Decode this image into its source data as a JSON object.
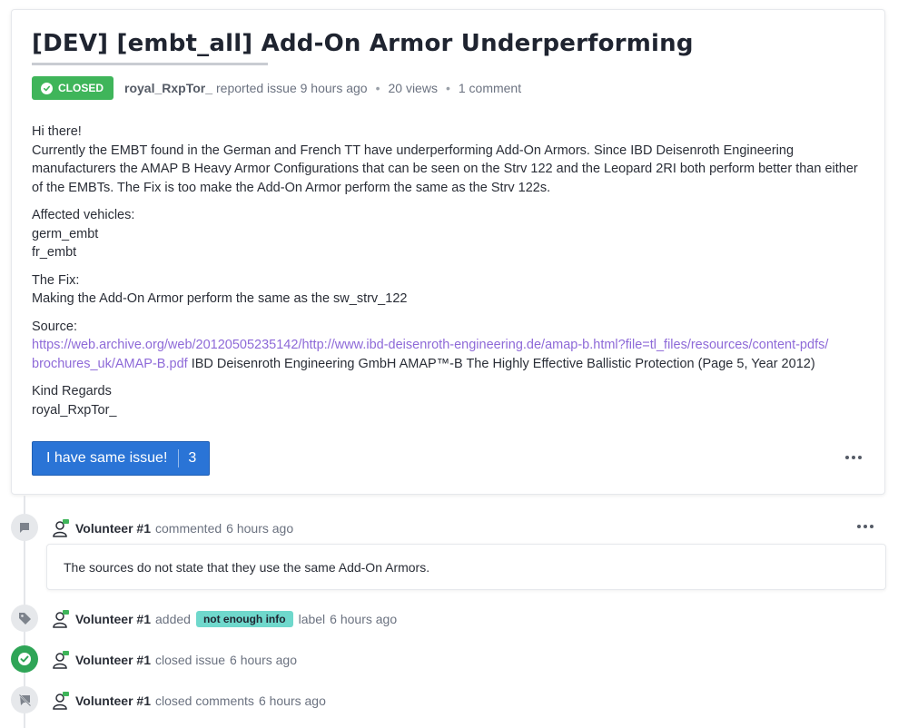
{
  "issue": {
    "title": "[DEV] [embt_all] Add-On Armor Underperforming",
    "status": "CLOSED",
    "author": "royal_RxpTor_",
    "reported_text": "reported issue 9 hours ago",
    "views": "20 views",
    "comments": "1 comment",
    "body": {
      "greeting": "Hi there!",
      "paragraph1": "Currently the EMBT found in the German and French TT have underperforming Add-On Armors. Since IBD Deisenroth Engineering manufacturers the AMAP B Heavy Armor Configurations that can be seen on the Strv 122 and the Leopard 2RI both perform better than either of the EMBTs. The Fix is too make the Add-On Armor perform the same as the Strv 122s.",
      "affected_label": "Affected vehicles:",
      "vehicle1": "germ_embt",
      "vehicle2": "fr_embt",
      "fix_label": "The Fix:",
      "fix_text": "Making the Add-On Armor perform the same as the sw_strv_122",
      "source_label": "Source:",
      "source_link_line1": "https://web.archive.org/web/20120505235142/http://www.ibd-deisenroth-engineering.de/amap-b.html?file=tl_files/resources/content-pdfs/",
      "source_link_line2": "brochures_uk/AMAP-B.pdf",
      "source_desc": " IBD Deisenroth Engineering GmbH AMAP™-B The Highly Effective Ballistic Protection (Page 5, Year 2012)",
      "closing": "Kind Regards",
      "signature": "royal_RxpTor_"
    },
    "same_issue_label": "I have same issue!",
    "same_issue_count": "3"
  },
  "timeline": {
    "comment_event": {
      "user": "Volunteer #1",
      "action": "commented",
      "time": "6 hours ago",
      "text": "The sources do not state that they use the same Add-On Armors."
    },
    "label_event": {
      "user": "Volunteer #1",
      "action": "added",
      "label": "not enough info",
      "suffix": "label",
      "time": "6 hours ago"
    },
    "close_event": {
      "user": "Volunteer #1",
      "action": "closed issue",
      "time": "6 hours ago"
    },
    "lock_event": {
      "user": "Volunteer #1",
      "action": "closed comments",
      "time": "6 hours ago"
    }
  },
  "icons": {
    "status_check": "check-circle-icon",
    "comment": "comment-icon",
    "tag": "tag-icon",
    "closed": "check-circle-icon",
    "comments_off": "comment-off-icon",
    "avatar": "volunteer-avatar-icon",
    "more": "more-options-icon"
  },
  "colors": {
    "closed_badge": "#3fb55a",
    "primary_button": "#2a74d6",
    "link": "#8e6ad8",
    "label_tag": "#6fd8cc",
    "closed_event": "#2fa557"
  }
}
